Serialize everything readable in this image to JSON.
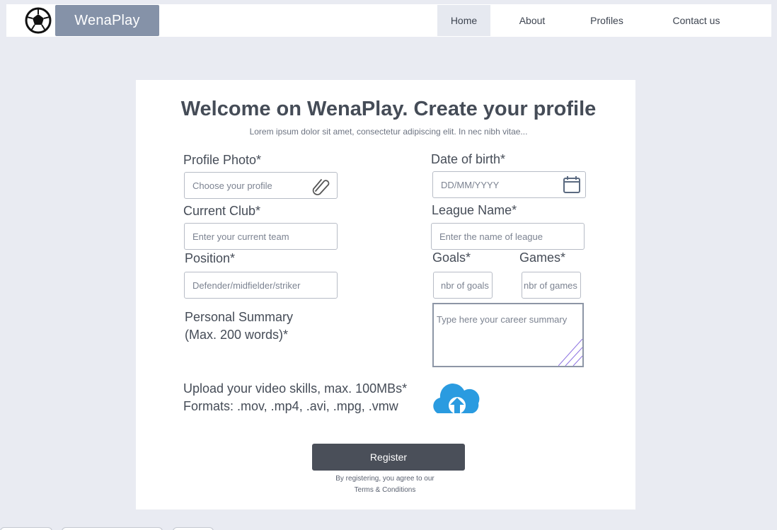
{
  "nav": {
    "brand": "WenaPlay",
    "items": [
      {
        "label": "Home",
        "active": true
      },
      {
        "label": "About",
        "active": false
      },
      {
        "label": "Profiles",
        "active": false
      },
      {
        "label": "Contact us",
        "active": false
      }
    ]
  },
  "form": {
    "title": "Welcome on WenaPlay. Create your profile",
    "subtitle": "Lorem ipsum dolor sit amet, consectetur adipiscing elit. In nec nibh vitae...",
    "profile_photo": {
      "label": "Profile Photo*",
      "placeholder": "Choose your profile",
      "icon": "paperclip-icon"
    },
    "date_of_birth": {
      "label": "Date of birth*",
      "placeholder": "DD/MM/YYYY",
      "icon": "calendar-icon"
    },
    "current_club": {
      "label": "Current Club*",
      "placeholder": "Enter your current team"
    },
    "league_name": {
      "label": "League Name*",
      "placeholder": "Enter  the name of league"
    },
    "position": {
      "label": "Position*",
      "placeholder": "Defender/midfielder/striker"
    },
    "goals": {
      "label": "Goals*",
      "placeholder": "nbr of goals"
    },
    "games": {
      "label": "Games*",
      "placeholder": "nbr of games"
    },
    "summary": {
      "label_line1": "Personal Summary",
      "label_line2": "(Max. 200 words)*",
      "placeholder": "Type here your career summary"
    },
    "upload": {
      "line1": "Upload your video skills, max. 100MBs*",
      "line2": "Formats: .mov, .mp4, .avi, .mpg, .vmw",
      "icon": "cloud-upload-icon"
    },
    "register_label": "Register",
    "terms_line1": "By registering, you agree to our",
    "terms_link": "Terms & Conditions"
  },
  "colors": {
    "background": "#e9ebf2",
    "brand": "#8592a8",
    "button": "#4a4f59",
    "cloud": "#2a9be0"
  }
}
